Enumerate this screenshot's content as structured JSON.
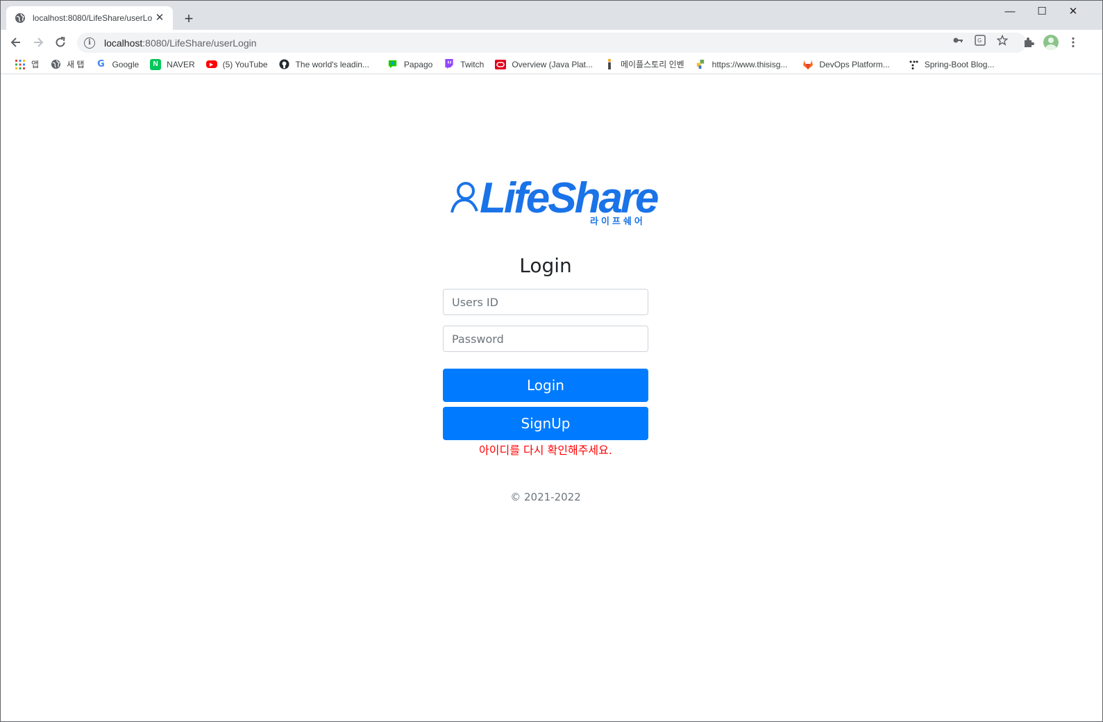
{
  "browser": {
    "tab_title": "localhost:8080/LifeShare/userLo",
    "new_tab_label": "+",
    "url_host": "localhost",
    "url_path": ":8080/LifeShare/userLogin",
    "window_controls": {
      "minimize": "—",
      "maximize": "☐",
      "close": "✕"
    }
  },
  "bookmarks": [
    {
      "label": "앱",
      "icon": "apps-grid-icon",
      "color": "#ea4335"
    },
    {
      "label": "새 탭",
      "icon": "globe-icon",
      "color": "#5f6368"
    },
    {
      "label": "Google",
      "icon": "google-icon",
      "color": "#4285f4"
    },
    {
      "label": "NAVER",
      "icon": "naver-icon",
      "color": "#03c75a"
    },
    {
      "label": "(5) YouTube",
      "icon": "youtube-icon",
      "color": "#ff0000"
    },
    {
      "label": "The world's leadin...",
      "icon": "github-icon",
      "color": "#24292e"
    },
    {
      "label": "Papago",
      "icon": "papago-icon",
      "color": "#1ec800"
    },
    {
      "label": "Twitch",
      "icon": "twitch-icon",
      "color": "#9146ff"
    },
    {
      "label": "Overview (Java Plat...",
      "icon": "oracle-icon",
      "color": "#e0001b"
    },
    {
      "label": "메이플스토리 인벤",
      "icon": "inven-icon",
      "color": "#f5a623"
    },
    {
      "label": "https://www.thisisg...",
      "icon": "puzzle-bookmark-icon",
      "color": "#6aa84f"
    },
    {
      "label": "DevOps Platform...",
      "icon": "gitlab-icon",
      "color": "#fc6d26"
    },
    {
      "label": "Spring-Boot Blog...",
      "icon": "dots-icon",
      "color": "#202124"
    }
  ],
  "logo": {
    "text": "LifeShare",
    "subtitle": "라이프쉐어",
    "color": "#1a73e8"
  },
  "login": {
    "title": "Login",
    "user_placeholder": "Users ID",
    "password_placeholder": "Password",
    "login_button": "Login",
    "signup_button": "SignUp",
    "error_message": "아이디를 다시 확인해주세요.",
    "copyright": "© 2021-2022"
  },
  "colors": {
    "primary": "#007bff",
    "error": "#ff0000",
    "muted": "#6c757d"
  }
}
